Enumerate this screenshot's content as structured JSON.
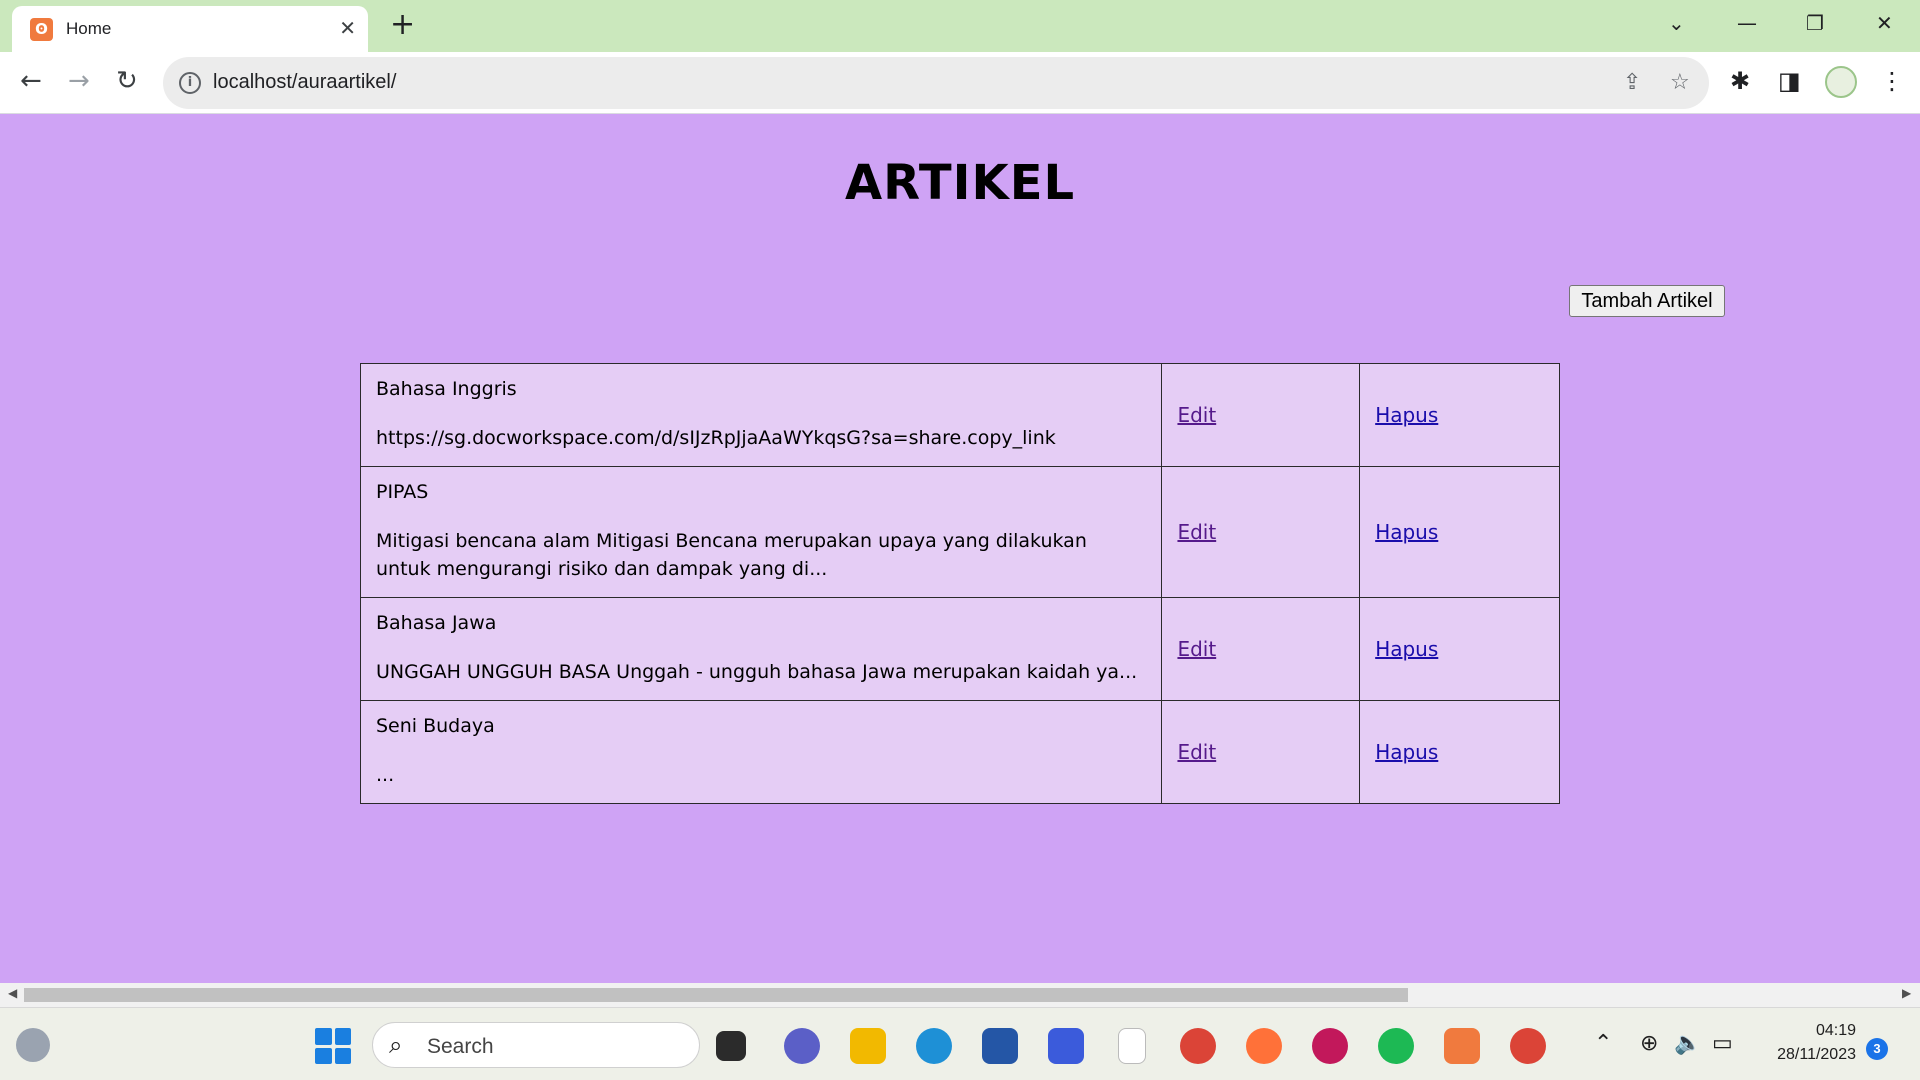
{
  "browser": {
    "tab_title": "Home",
    "tab_close": "✕",
    "new_tab": "+",
    "url": "localhost/auraartikel/"
  },
  "page": {
    "title": "ARTIKEL",
    "add_button": "Tambah Artikel",
    "articles": [
      {
        "title": "Bahasa Inggris",
        "body": "https://sg.docworkspace.com/d/sIJzRpJjaAaWYkqsG?sa=share.copy_link",
        "edit": "Edit",
        "delete": "Hapus"
      },
      {
        "title": "PIPAS",
        "body": "Mitigasi bencana alam Mitigasi Bencana merupakan upaya yang dilakukan untuk mengurangi risiko dan dampak yang di...",
        "edit": "Edit",
        "delete": "Hapus"
      },
      {
        "title": "Bahasa Jawa",
        "body": "UNGGAH UNGGUH BASA Unggah - ungguh bahasa Jawa merupakan kaidah ya...",
        "edit": "Edit",
        "delete": "Hapus"
      },
      {
        "title": "Seni Budaya",
        "body": "...",
        "edit": "Edit",
        "delete": "Hapus"
      }
    ]
  },
  "taskbar": {
    "search_placeholder": "Search",
    "time": "04:19",
    "date": "28/11/2023",
    "notification_count": "3"
  },
  "colors": {
    "page_background": "#cfa3f5",
    "table_background": "#e5cdf5",
    "tabbar_background": "#cbe8bd"
  }
}
